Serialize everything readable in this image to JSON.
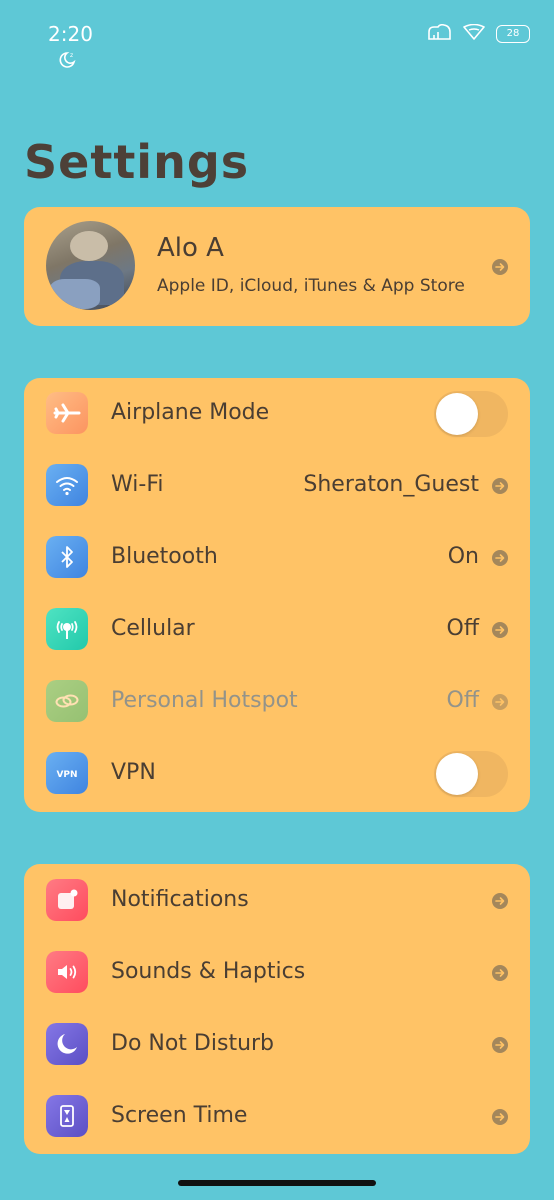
{
  "status_bar": {
    "time": "2:20",
    "battery": "28"
  },
  "page": {
    "title": "Settings"
  },
  "profile": {
    "name": "Alo A",
    "subtitle": "Apple ID, iCloud, iTunes & App Store"
  },
  "network": {
    "items": [
      {
        "label": "Airplane Mode",
        "icon": "airplane-icon",
        "toggle": false,
        "color": "#fba56e"
      },
      {
        "label": "Wi-Fi",
        "value": "Sheraton_Guest",
        "icon": "wifi-icon",
        "color": "#4f97e6"
      },
      {
        "label": "Bluetooth",
        "value": "On",
        "icon": "bluetooth-icon",
        "color": "#4f97e6"
      },
      {
        "label": "Cellular",
        "value": "Off",
        "icon": "cellular-icon",
        "color": "#2fd6b6"
      },
      {
        "label": "Personal Hotspot",
        "value": "Off",
        "icon": "hotspot-icon",
        "color": "#3bc98a",
        "disabled": true
      },
      {
        "label": "VPN",
        "icon": "vpn-icon",
        "icon_text": "VPN",
        "toggle": false,
        "color": "#4f97e6"
      }
    ]
  },
  "notifications": {
    "items": [
      {
        "label": "Notifications",
        "icon": "notifications-icon",
        "color": "#ff5b6b"
      },
      {
        "label": "Sounds & Haptics",
        "icon": "sound-icon",
        "color": "#ff5b6b"
      },
      {
        "label": "Do Not Disturb",
        "icon": "moon-icon",
        "color": "#6b5fcf"
      },
      {
        "label": "Screen Time",
        "icon": "hourglass-icon",
        "color": "#6b5fcf"
      }
    ]
  }
}
